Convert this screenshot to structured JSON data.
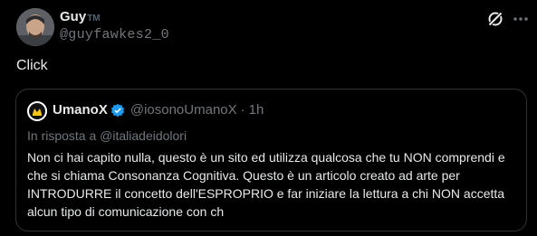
{
  "author": {
    "display_name": "Guy",
    "badge": "TM",
    "handle": "@guyfawkes2_0"
  },
  "tweet": {
    "text": "Click"
  },
  "quoted": {
    "display_name": "UmanoX",
    "handle": "@iosonoUmanoX",
    "separator": "·",
    "time": "1h",
    "reply_to": "In risposta a @italiadeidolori",
    "text": "Non ci hai capito nulla, questo è un sito ed utilizza qualcosa che tu NON comprendi e che si chiama Consonanza Cognitiva. Questo è un articolo creato ad arte per INTRODURRE il concetto dell'ESPROPRIO e far iniziare la lettura a chi NON accetta alcun tipo di comunicazione con ch"
  },
  "icons": {
    "grok": "grok-icon",
    "more": "more-icon",
    "verified": "verified-icon"
  },
  "colors": {
    "background": "#000000",
    "text": "#e7e9ea",
    "muted": "#71767b",
    "verified": "#1d9bf0",
    "border": "#2f3336"
  }
}
